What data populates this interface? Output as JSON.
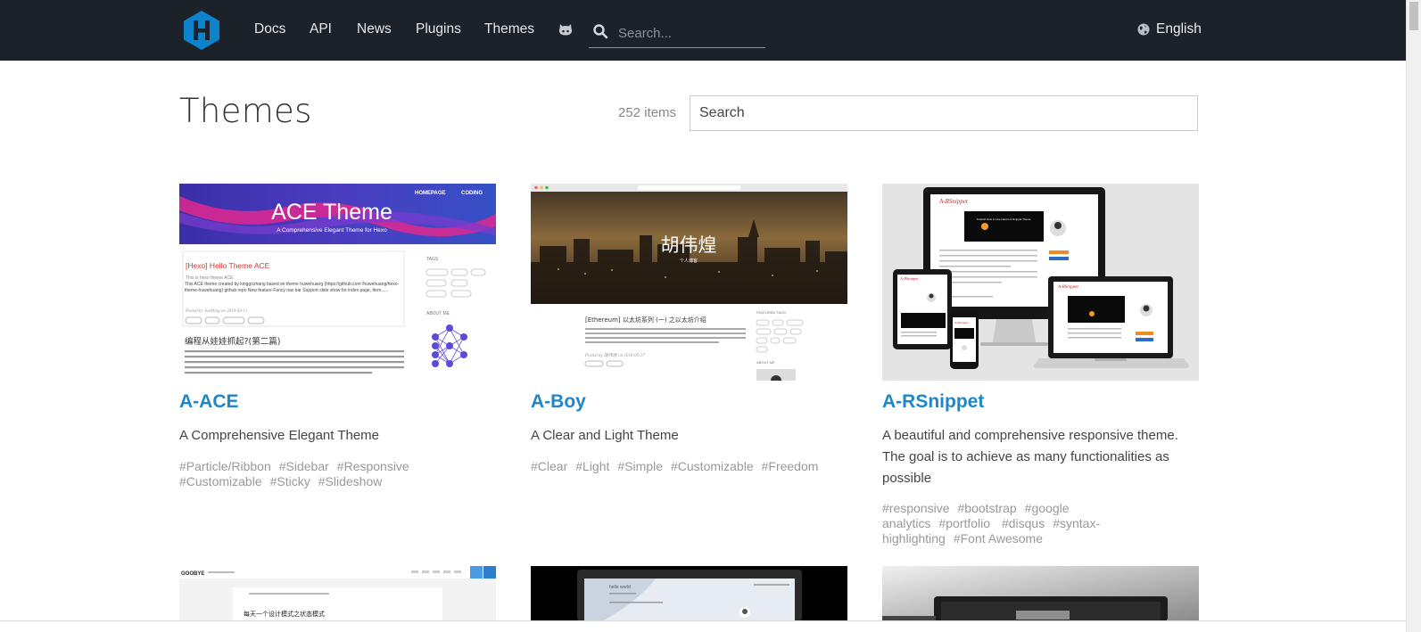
{
  "nav": {
    "items": [
      {
        "label": "Docs"
      },
      {
        "label": "API"
      },
      {
        "label": "News"
      },
      {
        "label": "Plugins"
      },
      {
        "label": "Themes"
      }
    ],
    "search_placeholder": "Search...",
    "language": "English"
  },
  "page": {
    "title": "Themes",
    "count_label": "252 items",
    "search_placeholder": "Search"
  },
  "thumbnails": {
    "ace": {
      "nav": [
        "HOMEPAGE",
        "CODING"
      ],
      "title": "ACE Theme",
      "subtitle": "A Comprehensive Elegant Theme for Hexo",
      "post_title": "[Hexo] Hello Theme ACE",
      "post_sub": "This is hexo theme ACE",
      "post_body": "This ACE theme created by kinggozhang based on theme huwehuang (https://github.com /huwehuang/hexo-theme-huwehuang) github repo New feature Fancy nav bar Support slide show for index page, Item......",
      "post_date": "Posted by JunMing on 2019-04-13",
      "post2_title": "编程从娃娃抓起?(第二篇)",
      "sidebar_tags": "TAGS",
      "sidebar_about": "ABOUT ME"
    },
    "boy": {
      "name": "胡伟煌",
      "caption": "个人博客",
      "post_title": "[Ethereum] 以太坊系列 (一) 之以太坊介绍",
      "post_date": "Posted by 胡伟煌 on 2018-06-27",
      "sidebar_tags": "FEATURED TAGS",
      "sidebar_about": "ABOUT ME"
    },
    "rsnippet": {
      "brand": "A-RSnippet",
      "video_title": "Tutorial: How to Use Hexo's A-Snippet Theme"
    },
    "row2": {
      "c4_brand": "GOOBYE",
      "c4_heading": "每天一个设计模式之状态模式",
      "c5_title": "hello world"
    }
  },
  "cards": [
    {
      "title": "A-ACE",
      "description": "A Comprehensive Elegant Theme",
      "tags": [
        "#Particle/Ribbon",
        "#Sidebar",
        "#Responsive",
        "#Customizable",
        "#Sticky",
        "#Slideshow"
      ]
    },
    {
      "title": "A-Boy",
      "description": "A Clear and Light Theme",
      "tags": [
        "#Clear",
        "#Light",
        "#Simple",
        "#Customizable",
        "#Freedom"
      ]
    },
    {
      "title": "A-RSnippet",
      "description": "A beautiful and comprehensive responsive theme. The goal is to achieve as many functionalities as possible",
      "tags": [
        "#responsive",
        "#bootstrap",
        "#google analytics",
        "#portfolio",
        "#disqus",
        "#syntax-highlighting",
        "#Font Awesome"
      ]
    }
  ],
  "colors": {
    "header_bg": "#1c2229",
    "link": "#1e87c7",
    "logo": "#0e83cd",
    "tag": "#999999"
  }
}
